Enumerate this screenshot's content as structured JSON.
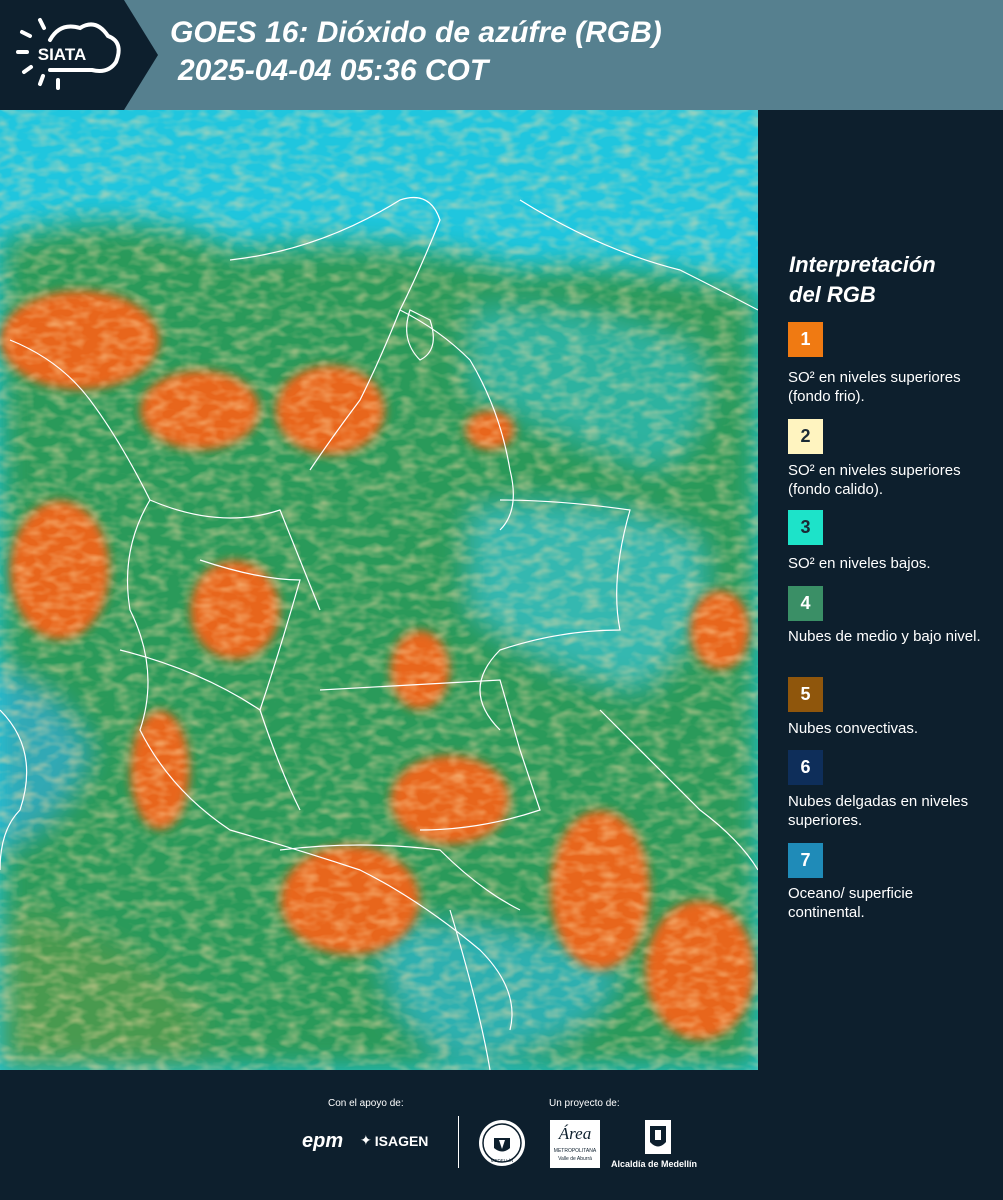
{
  "header": {
    "title_line1": "GOES 16: Dióxido de azúfre (RGB)",
    "title_line2": "2025-04-04 05:36 COT",
    "logo_text": "SIATA"
  },
  "legend": {
    "title_line1": "Interpretación",
    "title_line2": "del RGB",
    "items": [
      {
        "number": "1",
        "color": "#f07a12",
        "text": "SO² en niveles superiores (fondo frio)."
      },
      {
        "number": "2",
        "color": "#fff4c0",
        "text": "SO² en niveles superiores (fondo calido)."
      },
      {
        "number": "3",
        "color": "#1de3c9",
        "text": "SO² en niveles bajos."
      },
      {
        "number": "4",
        "color": "#3a8f66",
        "text": "Nubes de medio y bajo nivel."
      },
      {
        "number": "5",
        "color": "#8f560c",
        "text": "Nubes convectivas."
      },
      {
        "number": "6",
        "color": "#0e2e5a",
        "text": "Nubes delgadas en niveles superiores."
      },
      {
        "number": "7",
        "color": "#1f8bb8",
        "text": "Oceano/ superficie continental."
      }
    ]
  },
  "footer": {
    "support_caption": "Con el apoyo de:",
    "project_caption": "Un proyecto de:",
    "epm_logo": "epm",
    "isagen_logo": "ISAGEN",
    "area_logo": "Área",
    "area_sub1": "METROPOLITANA",
    "area_sub2": "Valle de Aburrá",
    "alcaldia_logo": "Alcaldía de Medellín",
    "medellin_seal": "MEDELLÍN"
  },
  "colors": {
    "background": "#0d1f2d",
    "header": "#56808f",
    "ocean": "#20c6de",
    "land": "#2a9a5a",
    "convective": "#e8661e",
    "border": "#ffffff"
  }
}
